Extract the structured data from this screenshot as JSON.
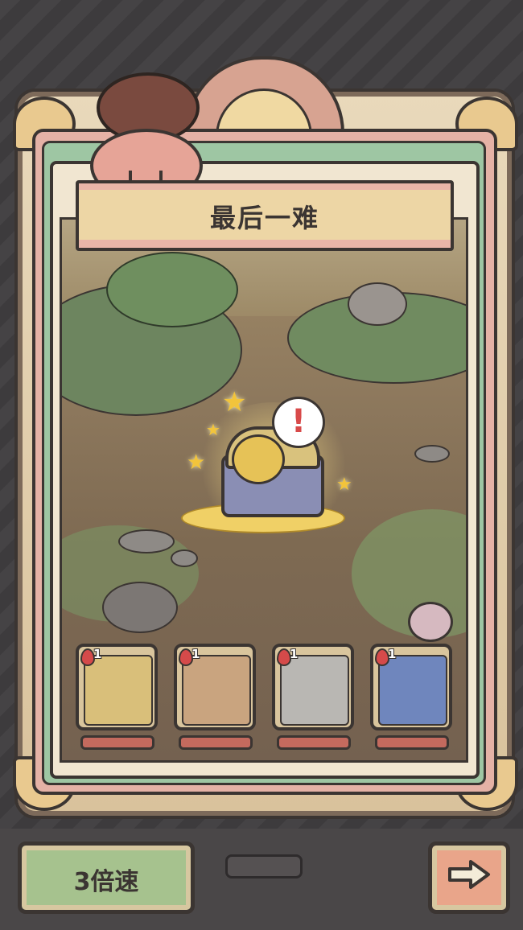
{
  "stage": {
    "title": "最后一难"
  },
  "battle": {
    "alert_symbol": "!"
  },
  "heroes": [
    {
      "level": "1",
      "color": "#d9bf7a"
    },
    {
      "level": "1",
      "color": "#c9a47f"
    },
    {
      "level": "1",
      "color": "#b9b7b3"
    },
    {
      "level": "1",
      "color": "#6f86bd"
    }
  ],
  "controls": {
    "speed_label": "3倍速",
    "next_icon": "right-arrow-icon"
  },
  "colors": {
    "hp_bar": "#c46a5e",
    "speed_button": "#a6c28e",
    "next_button": "#e9a58a"
  }
}
